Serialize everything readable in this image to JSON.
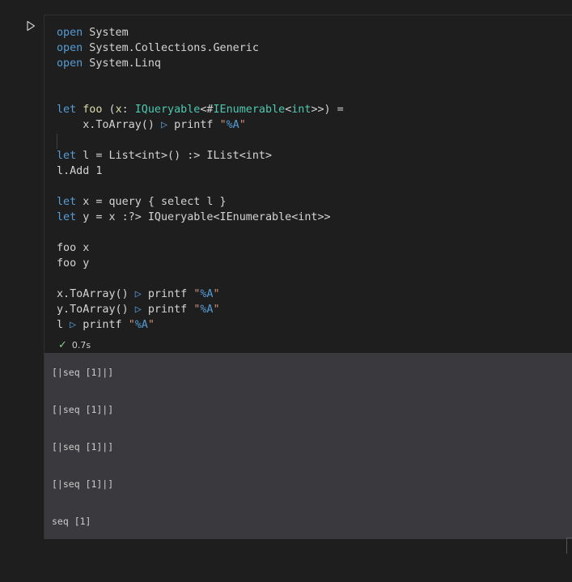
{
  "run_button": {
    "icon": "play-icon"
  },
  "code_lines": [
    [
      {
        "t": "open",
        "c": "kw"
      },
      {
        "t": " System",
        "c": ""
      }
    ],
    [
      {
        "t": "open",
        "c": "kw"
      },
      {
        "t": " System.Collections.Generic",
        "c": ""
      }
    ],
    [
      {
        "t": "open",
        "c": "kw"
      },
      {
        "t": " System.Linq",
        "c": ""
      }
    ],
    [],
    [],
    [
      {
        "t": "let",
        "c": "kw"
      },
      {
        "t": " ",
        "c": ""
      },
      {
        "t": "foo",
        "c": "fn"
      },
      {
        "t": " (",
        "c": ""
      },
      {
        "t": "x",
        "c": "fn"
      },
      {
        "t": ": ",
        "c": ""
      },
      {
        "t": "IQueryable",
        "c": "ty"
      },
      {
        "t": "<#",
        "c": ""
      },
      {
        "t": "IEnumerable",
        "c": "ty"
      },
      {
        "t": "<",
        "c": ""
      },
      {
        "t": "int",
        "c": "ty"
      },
      {
        "t": ">>) =",
        "c": ""
      }
    ],
    [
      {
        "t": "    x.ToArray() ",
        "c": ""
      },
      {
        "t": "▷",
        "c": "op"
      },
      {
        "t": " printf ",
        "c": ""
      },
      {
        "t": "\"",
        "c": "st"
      },
      {
        "t": "%A",
        "c": "fmt"
      },
      {
        "t": "\"",
        "c": "st"
      }
    ],
    [],
    [
      {
        "t": "let",
        "c": "kw"
      },
      {
        "t": " l = List<int>() :> IList<int>",
        "c": ""
      }
    ],
    [
      {
        "t": "l.Add 1",
        "c": ""
      }
    ],
    [],
    [
      {
        "t": "let",
        "c": "kw"
      },
      {
        "t": " x = query { select l }",
        "c": ""
      }
    ],
    [
      {
        "t": "let",
        "c": "kw"
      },
      {
        "t": " y = x :?> IQueryable<IEnumerable<int>>",
        "c": ""
      }
    ],
    [],
    [
      {
        "t": "foo x",
        "c": ""
      }
    ],
    [
      {
        "t": "foo y",
        "c": ""
      }
    ],
    [],
    [
      {
        "t": "x.ToArray() ",
        "c": ""
      },
      {
        "t": "▷",
        "c": "op"
      },
      {
        "t": " printf ",
        "c": ""
      },
      {
        "t": "\"",
        "c": "st"
      },
      {
        "t": "%A",
        "c": "fmt"
      },
      {
        "t": "\"",
        "c": "st"
      }
    ],
    [
      {
        "t": "y.ToArray() ",
        "c": ""
      },
      {
        "t": "▷",
        "c": "op"
      },
      {
        "t": " printf ",
        "c": ""
      },
      {
        "t": "\"",
        "c": "st"
      },
      {
        "t": "%A",
        "c": "fmt"
      },
      {
        "t": "\"",
        "c": "st"
      }
    ],
    [
      {
        "t": "l ",
        "c": ""
      },
      {
        "t": "▷",
        "c": "op"
      },
      {
        "t": " printf ",
        "c": ""
      },
      {
        "t": "\"",
        "c": "st"
      },
      {
        "t": "%A",
        "c": "fmt"
      },
      {
        "t": "\"",
        "c": "st"
      }
    ]
  ],
  "status": {
    "icon": "check-icon",
    "time": "0.7s"
  },
  "outputs": [
    "[|seq [1]|]",
    "[|seq [1]|]",
    "[|seq [1]|]",
    "[|seq [1]|]",
    "seq [1]"
  ],
  "colors": {
    "keyword": "#569cd6",
    "type": "#4ec9b0",
    "function": "#dcdcaa",
    "string": "#ce9178",
    "success": "#89d185"
  }
}
